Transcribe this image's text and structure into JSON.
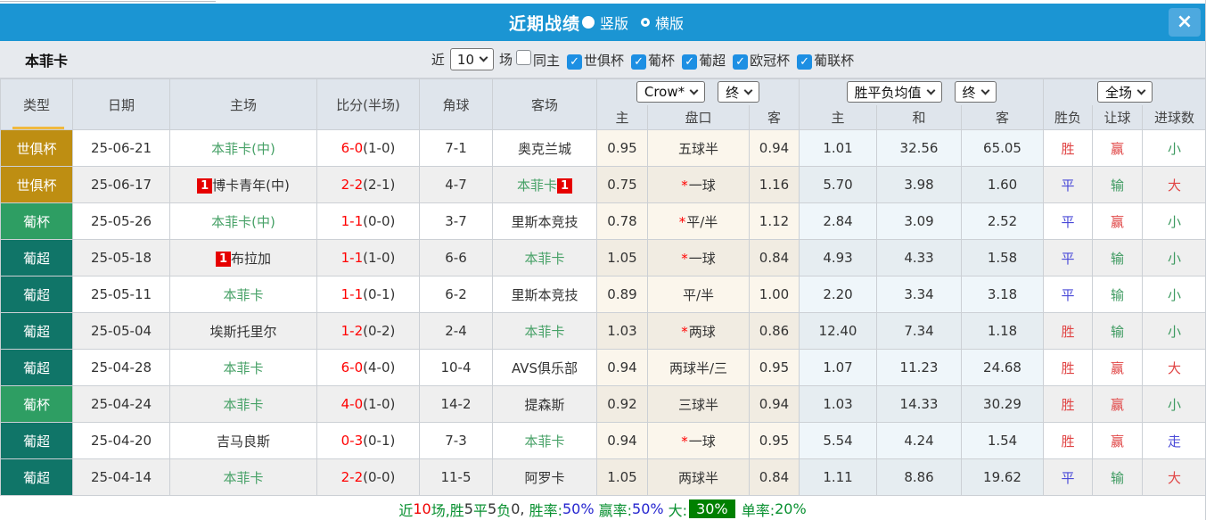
{
  "titlebar": {
    "title": "近期战绩",
    "layout_options": [
      {
        "label": "竖版",
        "selected": true
      },
      {
        "label": "横版",
        "selected": false
      }
    ],
    "close_label": "×"
  },
  "filterbar": {
    "team": "本菲卡",
    "near_label": "近",
    "near_value": "10",
    "games_label": "场",
    "checkboxes": [
      {
        "label": "同主",
        "checked": false
      },
      {
        "label": "世俱杯",
        "checked": true
      },
      {
        "label": "葡杯",
        "checked": true
      },
      {
        "label": "葡超",
        "checked": true
      },
      {
        "label": "欧冠杯",
        "checked": true
      },
      {
        "label": "葡联杯",
        "checked": true
      }
    ],
    "checkbox_color": "#1d8fe3"
  },
  "table": {
    "left_headers": [
      "类型",
      "日期",
      "主场",
      "比分(半场)",
      "角球",
      "客场"
    ],
    "dropdowns": [
      {
        "label": "Crow*"
      },
      {
        "label": "终"
      },
      {
        "label": "胜平负均值"
      },
      {
        "label": "终"
      },
      {
        "label": "全场"
      }
    ],
    "sub_headers": [
      "主",
      "盘口",
      "客",
      "主",
      "和",
      "客",
      "胜负",
      "让球",
      "进球数"
    ],
    "type_colors": {
      "世俱杯": "#be8e12",
      "葡杯": "#2e9e63",
      "葡超": "#107568"
    },
    "result_colors": {
      "red": "#e04545",
      "blue": "#4a4ad8",
      "green": "#3d9a60"
    },
    "rows": [
      {
        "type": "世俱杯",
        "date": "25-06-21",
        "home": {
          "text": "本菲卡(中)",
          "green": true,
          "badge_before": false,
          "badge_after": false
        },
        "score": "6-0",
        "half": "(1-0)",
        "corner": "7-1",
        "away": {
          "text": "奥克兰城",
          "green": false,
          "badge_before": false,
          "badge_after": false
        },
        "odds_home": "0.95",
        "handicap_star": false,
        "handicap": "五球半",
        "odds_away": "0.94",
        "avg_home": "1.01",
        "avg_draw": "32.56",
        "avg_away": "65.05",
        "wdl": {
          "text": "胜",
          "color": "red"
        },
        "handicap_res": {
          "text": "赢",
          "color": "red"
        },
        "goals_res": {
          "text": "小",
          "color": "green"
        }
      },
      {
        "type": "世俱杯",
        "date": "25-06-17",
        "home": {
          "text": "博卡青年(中)",
          "green": false,
          "badge_before": true,
          "badge_after": false
        },
        "score": "2-2",
        "half": "(2-1)",
        "corner": "4-7",
        "away": {
          "text": "本菲卡",
          "green": true,
          "badge_before": false,
          "badge_after": true
        },
        "odds_home": "0.75",
        "handicap_star": true,
        "handicap": "一球",
        "odds_away": "1.16",
        "avg_home": "5.70",
        "avg_draw": "3.98",
        "avg_away": "1.60",
        "wdl": {
          "text": "平",
          "color": "blue"
        },
        "handicap_res": {
          "text": "输",
          "color": "green"
        },
        "goals_res": {
          "text": "大",
          "color": "red"
        }
      },
      {
        "type": "葡杯",
        "date": "25-05-26",
        "home": {
          "text": "本菲卡(中)",
          "green": true,
          "badge_before": false,
          "badge_after": false
        },
        "score": "1-1",
        "half": "(0-0)",
        "corner": "3-7",
        "away": {
          "text": "里斯本竞技",
          "green": false,
          "badge_before": false,
          "badge_after": false
        },
        "odds_home": "0.78",
        "handicap_star": true,
        "handicap": "平/半",
        "odds_away": "1.12",
        "avg_home": "2.84",
        "avg_draw": "3.09",
        "avg_away": "2.52",
        "wdl": {
          "text": "平",
          "color": "blue"
        },
        "handicap_res": {
          "text": "赢",
          "color": "red"
        },
        "goals_res": {
          "text": "小",
          "color": "green"
        }
      },
      {
        "type": "葡超",
        "date": "25-05-18",
        "home": {
          "text": "布拉加",
          "green": false,
          "badge_before": true,
          "badge_after": false
        },
        "score": "1-1",
        "half": "(1-0)",
        "corner": "6-6",
        "away": {
          "text": "本菲卡",
          "green": true,
          "badge_before": false,
          "badge_after": false
        },
        "odds_home": "1.05",
        "handicap_star": true,
        "handicap": "一球",
        "odds_away": "0.84",
        "avg_home": "4.93",
        "avg_draw": "4.33",
        "avg_away": "1.58",
        "wdl": {
          "text": "平",
          "color": "blue"
        },
        "handicap_res": {
          "text": "输",
          "color": "green"
        },
        "goals_res": {
          "text": "小",
          "color": "green"
        }
      },
      {
        "type": "葡超",
        "date": "25-05-11",
        "home": {
          "text": "本菲卡",
          "green": true,
          "badge_before": false,
          "badge_after": false
        },
        "score": "1-1",
        "half": "(0-1)",
        "corner": "6-2",
        "away": {
          "text": "里斯本竞技",
          "green": false,
          "badge_before": false,
          "badge_after": false
        },
        "odds_home": "0.89",
        "handicap_star": false,
        "handicap": "平/半",
        "odds_away": "1.00",
        "avg_home": "2.20",
        "avg_draw": "3.34",
        "avg_away": "3.18",
        "wdl": {
          "text": "平",
          "color": "blue"
        },
        "handicap_res": {
          "text": "输",
          "color": "green"
        },
        "goals_res": {
          "text": "小",
          "color": "green"
        }
      },
      {
        "type": "葡超",
        "date": "25-05-04",
        "home": {
          "text": "埃斯托里尔",
          "green": false,
          "badge_before": false,
          "badge_after": false
        },
        "score": "1-2",
        "half": "(0-2)",
        "corner": "2-4",
        "away": {
          "text": "本菲卡",
          "green": true,
          "badge_before": false,
          "badge_after": false
        },
        "odds_home": "1.03",
        "handicap_star": true,
        "handicap": "两球",
        "odds_away": "0.86",
        "avg_home": "12.40",
        "avg_draw": "7.34",
        "avg_away": "1.18",
        "wdl": {
          "text": "胜",
          "color": "red"
        },
        "handicap_res": {
          "text": "输",
          "color": "green"
        },
        "goals_res": {
          "text": "小",
          "color": "green"
        }
      },
      {
        "type": "葡超",
        "date": "25-04-28",
        "home": {
          "text": "本菲卡",
          "green": true,
          "badge_before": false,
          "badge_after": false
        },
        "score": "6-0",
        "half": "(4-0)",
        "corner": "10-4",
        "away": {
          "text": "AVS俱乐部",
          "green": false,
          "badge_before": false,
          "badge_after": false
        },
        "odds_home": "0.94",
        "handicap_star": false,
        "handicap": "两球半/三",
        "odds_away": "0.95",
        "avg_home": "1.07",
        "avg_draw": "11.23",
        "avg_away": "24.68",
        "wdl": {
          "text": "胜",
          "color": "red"
        },
        "handicap_res": {
          "text": "赢",
          "color": "red"
        },
        "goals_res": {
          "text": "大",
          "color": "red"
        }
      },
      {
        "type": "葡杯",
        "date": "25-04-24",
        "home": {
          "text": "本菲卡",
          "green": true,
          "badge_before": false,
          "badge_after": false
        },
        "score": "4-0",
        "half": "(1-0)",
        "corner": "14-2",
        "away": {
          "text": "提森斯",
          "green": false,
          "badge_before": false,
          "badge_after": false
        },
        "odds_home": "0.92",
        "handicap_star": false,
        "handicap": "三球半",
        "odds_away": "0.94",
        "avg_home": "1.03",
        "avg_draw": "14.33",
        "avg_away": "30.29",
        "wdl": {
          "text": "胜",
          "color": "red"
        },
        "handicap_res": {
          "text": "赢",
          "color": "red"
        },
        "goals_res": {
          "text": "小",
          "color": "green"
        }
      },
      {
        "type": "葡超",
        "date": "25-04-20",
        "home": {
          "text": "吉马良斯",
          "green": false,
          "badge_before": false,
          "badge_after": false
        },
        "score": "0-3",
        "half": "(0-1)",
        "corner": "7-3",
        "away": {
          "text": "本菲卡",
          "green": true,
          "badge_before": false,
          "badge_after": false
        },
        "odds_home": "0.94",
        "handicap_star": true,
        "handicap": "一球",
        "odds_away": "0.95",
        "avg_home": "5.54",
        "avg_draw": "4.24",
        "avg_away": "1.54",
        "wdl": {
          "text": "胜",
          "color": "red"
        },
        "handicap_res": {
          "text": "赢",
          "color": "red"
        },
        "goals_res": {
          "text": "走",
          "color": "blue"
        }
      },
      {
        "type": "葡超",
        "date": "25-04-14",
        "home": {
          "text": "本菲卡",
          "green": true,
          "badge_before": false,
          "badge_after": false
        },
        "score": "2-2",
        "half": "(0-0)",
        "corner": "11-5",
        "away": {
          "text": "阿罗卡",
          "green": false,
          "badge_before": false,
          "badge_after": false
        },
        "odds_home": "1.05",
        "handicap_star": false,
        "handicap": "两球半",
        "odds_away": "0.84",
        "avg_home": "1.11",
        "avg_draw": "8.86",
        "avg_away": "19.62",
        "wdl": {
          "text": "平",
          "color": "blue"
        },
        "handicap_res": {
          "text": "输",
          "color": "green"
        },
        "goals_res": {
          "text": "大",
          "color": "red"
        }
      }
    ]
  },
  "summary": {
    "segments": [
      {
        "text": "近",
        "color": "green"
      },
      {
        "text": "10",
        "color": "red"
      },
      {
        "text": "场,",
        "color": "green"
      },
      {
        "text": "胜",
        "color": "green"
      },
      {
        "text": "5",
        "color": "dark"
      },
      {
        "text": "平",
        "color": "green"
      },
      {
        "text": "5",
        "color": "dark"
      },
      {
        "text": "负",
        "color": "green"
      },
      {
        "text": "0",
        "color": "dark"
      },
      {
        "text": ", ",
        "color": "dark"
      },
      {
        "text": "胜率:",
        "color": "green"
      },
      {
        "text": "50%",
        "color": "blue"
      },
      {
        "text": " 赢率:",
        "color": "green"
      },
      {
        "text": "50%",
        "color": "blue"
      },
      {
        "text": " 大:",
        "color": "green"
      },
      {
        "text": "30%",
        "color": "white",
        "highlight": true
      },
      {
        "text": " 单率:",
        "color": "green"
      },
      {
        "text": "20%",
        "color": "green"
      }
    ],
    "highlight_bg": "#008000"
  }
}
